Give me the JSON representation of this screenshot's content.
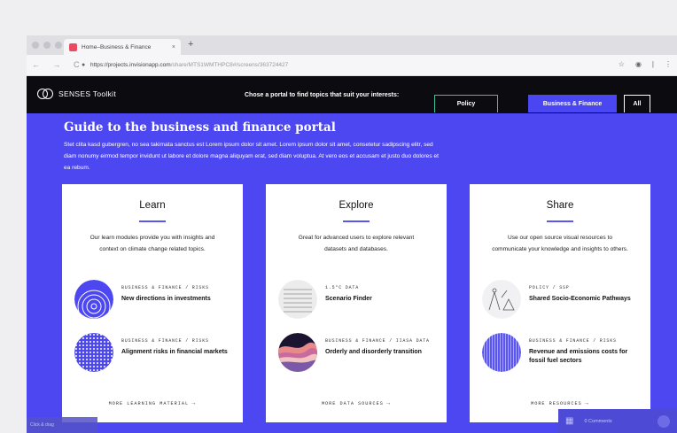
{
  "browser": {
    "tab_title": "Home–Business & Finance",
    "tab_close": "×",
    "new_tab": "+",
    "nav_glyphs": "← → C",
    "url_main": "https://projects.invisionapp.com",
    "url_rest": "/share/MTS1WMTHPC8#/screens/363724427"
  },
  "header": {
    "logo_text": "SENSES Toolkit",
    "prompt": "Chose a portal to find topics that suit your interests:",
    "portals": [
      "Policy",
      "Business & Finance",
      "All"
    ]
  },
  "hero": {
    "title": "Guide to the business and finance portal",
    "body": "Stet clita kasd gubergren, no sea takimata sanctus est Lorem ipsum dolor sit amet. Lorem ipsum dolor sit amet, consetetur sadipscing elitr, sed diam nonumy eirmod tempor invidunt ut labore et dolore magna aliquyam erat, sed diam voluptua. At vero eos et accusam et justo duo dolores et ea rebum."
  },
  "cards": {
    "learn": {
      "title": "Learn",
      "desc": "Our learn modules provide you with insights and context on climate change related topics.",
      "items": [
        {
          "cat": "BUSINESS & FINANCE / RISKS",
          "name": "New directions in investments"
        },
        {
          "cat": "BUSINESS & FINANCE / RISKS",
          "name": "Alignment risks in financial markets"
        }
      ],
      "more": "MORE LEARNING MATERIAL"
    },
    "explore": {
      "title": "Explore",
      "desc": "Great for advanced users to explore relevant datasets and databases.",
      "items": [
        {
          "cat": "1.5°C DATA",
          "name": "Scenario Finder"
        },
        {
          "cat": "BUSINESS & FINANCE / IIASA DATA",
          "name": "Orderly and disorderly transition"
        }
      ],
      "more": "MORE DATA SOURCES"
    },
    "share": {
      "title": "Share",
      "desc": "Use our open source visual resources to communicate your knowledge and insights to others.",
      "items": [
        {
          "cat": "POLICY / SSP",
          "name": "Shared Socio-Economic Pathways"
        },
        {
          "cat": "BUSINESS & FINANCE / RISKS",
          "name": "Revenue and emissions costs for fossil fuel sectors"
        }
      ],
      "more": "MORE RESOURCES"
    }
  },
  "overlay": {
    "left_text": "Click & drag",
    "comments": "0 Comments"
  },
  "colors": {
    "accent": "#4c47f0",
    "header_bg": "#0b0b10",
    "policy_border": "#3cbf9a"
  }
}
